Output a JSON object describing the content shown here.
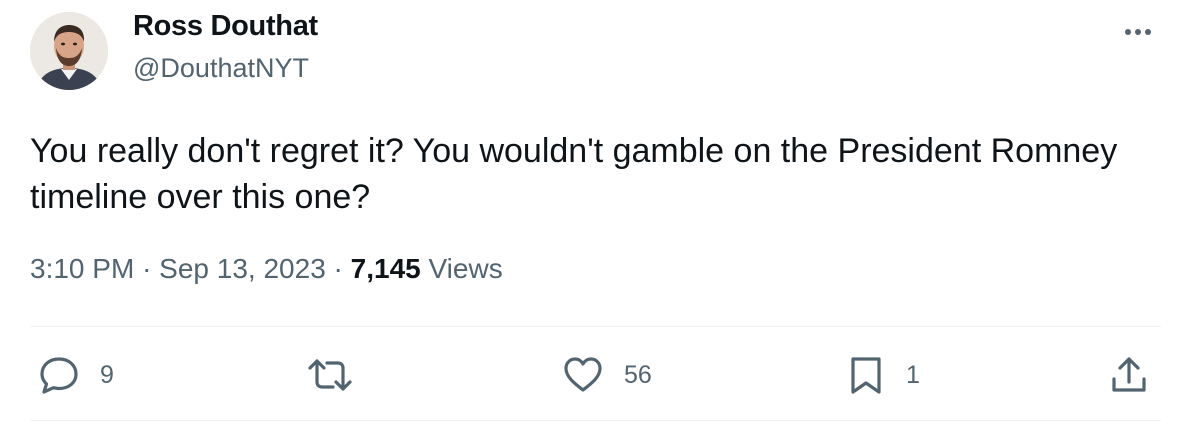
{
  "author": {
    "name": "Ross Douthat",
    "handle": "@DouthatNYT"
  },
  "tweet": {
    "text": "You really don't regret it? You wouldn't gamble on the President Romney timeline over this one?",
    "time": "3:10 PM",
    "date": "Sep 13, 2023",
    "separator": "·",
    "views_count": "7,145",
    "views_label": "Views"
  },
  "actions": {
    "reply_count": "9",
    "like_count": "56",
    "bookmark_count": "1"
  },
  "icons": {
    "more": "more-icon",
    "reply": "reply-icon",
    "retweet": "retweet-icon",
    "like": "heart-icon",
    "bookmark": "bookmark-icon",
    "share": "share-icon"
  },
  "colors": {
    "text_primary": "#0f1419",
    "text_secondary": "#536471",
    "divider": "#eff3f4"
  }
}
